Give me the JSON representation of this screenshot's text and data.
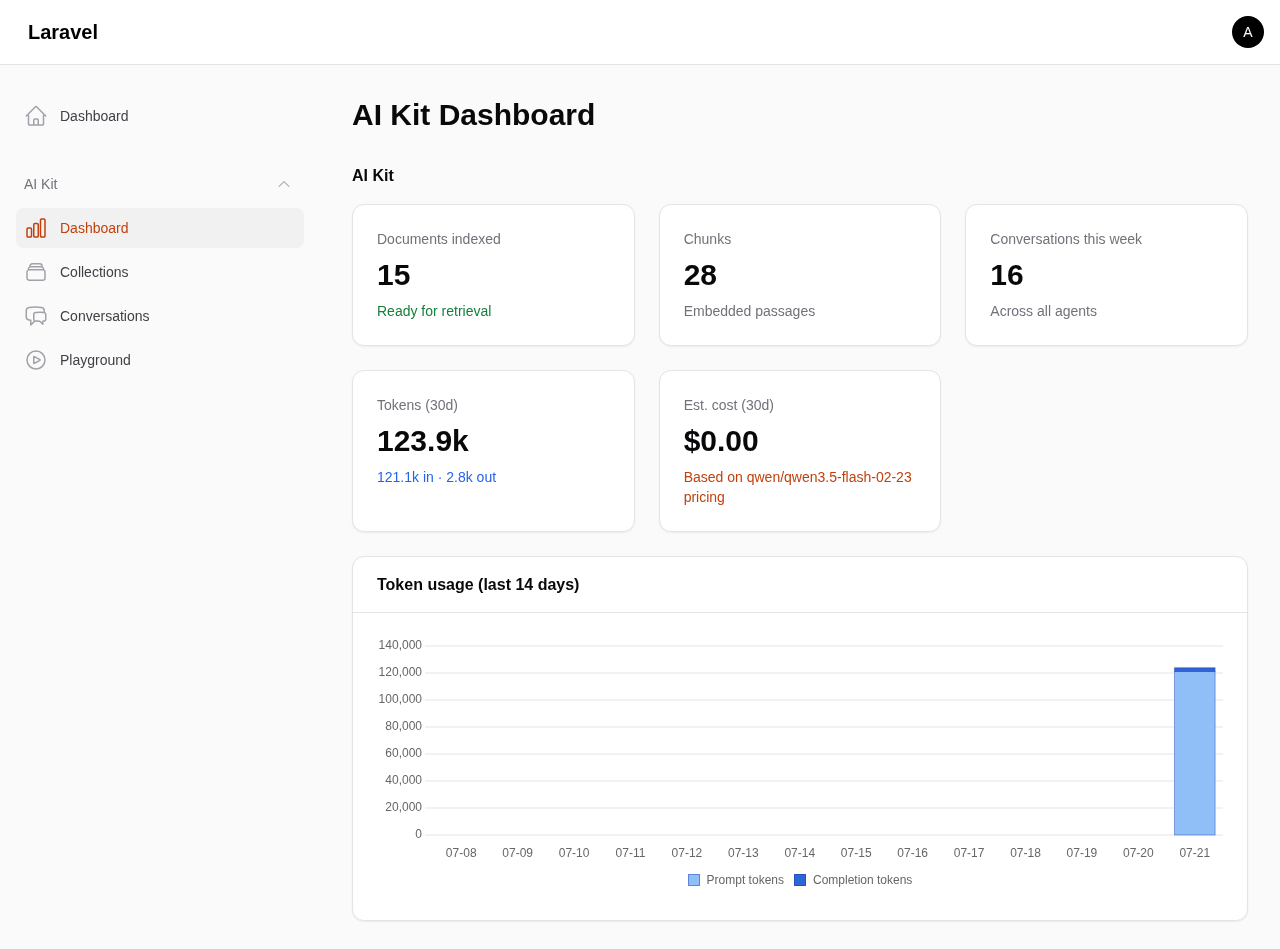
{
  "header": {
    "brand": "Laravel",
    "avatar": "A"
  },
  "sidebar": {
    "items": [
      {
        "label": "Dashboard",
        "selected": false
      }
    ],
    "groups": [
      {
        "label": "AI Kit",
        "expanded": true,
        "items": [
          {
            "label": "Dashboard",
            "selected": true
          },
          {
            "label": "Collections",
            "selected": false
          },
          {
            "label": "Conversations",
            "selected": false
          },
          {
            "label": "Playground",
            "selected": false
          }
        ]
      }
    ]
  },
  "page": {
    "title": "AI Kit Dashboard",
    "section_title": "AI Kit"
  },
  "stats": [
    {
      "label": "Documents indexed",
      "value": "15",
      "note": "Ready for retrieval",
      "color": "#15803d"
    },
    {
      "label": "Chunks",
      "value": "28",
      "note": "Embedded passages",
      "color": "#71717a"
    },
    {
      "label": "Conversations this week",
      "value": "16",
      "note": "Across all agents",
      "color": "#71717a"
    },
    {
      "label": "Tokens (30d)",
      "value": "123.9k",
      "note": "121.1k in · 2.8k out",
      "color": "#2563eb"
    },
    {
      "label": "Est. cost (30d)",
      "value": "$0.00",
      "note": "Based on qwen/qwen3.5-flash-02-23 pricing",
      "color": "#c2410c"
    }
  ],
  "chart_card": {
    "title": "Token usage (last 14 days)",
    "chart_data": {
      "type": "bar",
      "stacked": true,
      "categories": [
        "07-08",
        "07-09",
        "07-10",
        "07-11",
        "07-12",
        "07-13",
        "07-14",
        "07-15",
        "07-16",
        "07-17",
        "07-18",
        "07-19",
        "07-20",
        "07-21"
      ],
      "series": [
        {
          "name": "Prompt tokens",
          "color": "#90bff8",
          "values": [
            0,
            0,
            0,
            0,
            0,
            0,
            0,
            0,
            0,
            0,
            0,
            0,
            0,
            121100
          ]
        },
        {
          "name": "Completion tokens",
          "color": "#2f63d6",
          "values": [
            0,
            0,
            0,
            0,
            0,
            0,
            0,
            0,
            0,
            0,
            0,
            0,
            0,
            2800
          ]
        }
      ],
      "ylim": [
        0,
        140000
      ],
      "yticks": [
        {
          "value": 0,
          "label": "0"
        },
        {
          "value": 20000,
          "label": "20,000"
        },
        {
          "value": 40000,
          "label": "40,000"
        },
        {
          "value": 60000,
          "label": "60,000"
        },
        {
          "value": 80000,
          "label": "80,000"
        },
        {
          "value": 100000,
          "label": "100,000"
        },
        {
          "value": 120000,
          "label": "120,000"
        },
        {
          "value": 140000,
          "label": "140,000"
        }
      ],
      "grid": true,
      "legend": "bottom"
    }
  }
}
